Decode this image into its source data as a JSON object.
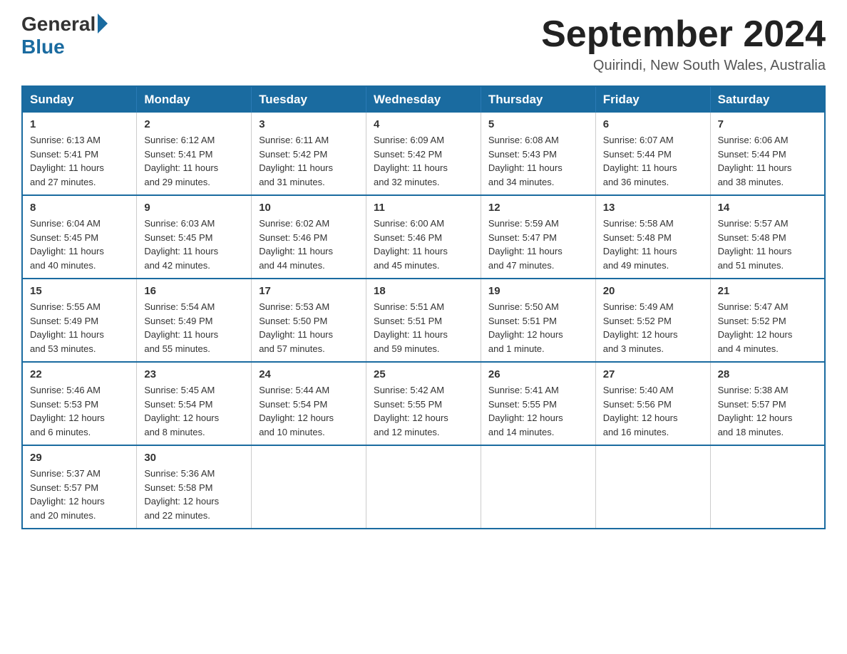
{
  "header": {
    "logo_general": "General",
    "logo_blue": "Blue",
    "month_title": "September 2024",
    "location": "Quirindi, New South Wales, Australia"
  },
  "calendar": {
    "days_of_week": [
      "Sunday",
      "Monday",
      "Tuesday",
      "Wednesday",
      "Thursday",
      "Friday",
      "Saturday"
    ],
    "weeks": [
      [
        {
          "day": "1",
          "sunrise": "6:13 AM",
          "sunset": "5:41 PM",
          "daylight": "11 hours and 27 minutes."
        },
        {
          "day": "2",
          "sunrise": "6:12 AM",
          "sunset": "5:41 PM",
          "daylight": "11 hours and 29 minutes."
        },
        {
          "day": "3",
          "sunrise": "6:11 AM",
          "sunset": "5:42 PM",
          "daylight": "11 hours and 31 minutes."
        },
        {
          "day": "4",
          "sunrise": "6:09 AM",
          "sunset": "5:42 PM",
          "daylight": "11 hours and 32 minutes."
        },
        {
          "day": "5",
          "sunrise": "6:08 AM",
          "sunset": "5:43 PM",
          "daylight": "11 hours and 34 minutes."
        },
        {
          "day": "6",
          "sunrise": "6:07 AM",
          "sunset": "5:44 PM",
          "daylight": "11 hours and 36 minutes."
        },
        {
          "day": "7",
          "sunrise": "6:06 AM",
          "sunset": "5:44 PM",
          "daylight": "11 hours and 38 minutes."
        }
      ],
      [
        {
          "day": "8",
          "sunrise": "6:04 AM",
          "sunset": "5:45 PM",
          "daylight": "11 hours and 40 minutes."
        },
        {
          "day": "9",
          "sunrise": "6:03 AM",
          "sunset": "5:45 PM",
          "daylight": "11 hours and 42 minutes."
        },
        {
          "day": "10",
          "sunrise": "6:02 AM",
          "sunset": "5:46 PM",
          "daylight": "11 hours and 44 minutes."
        },
        {
          "day": "11",
          "sunrise": "6:00 AM",
          "sunset": "5:46 PM",
          "daylight": "11 hours and 45 minutes."
        },
        {
          "day": "12",
          "sunrise": "5:59 AM",
          "sunset": "5:47 PM",
          "daylight": "11 hours and 47 minutes."
        },
        {
          "day": "13",
          "sunrise": "5:58 AM",
          "sunset": "5:48 PM",
          "daylight": "11 hours and 49 minutes."
        },
        {
          "day": "14",
          "sunrise": "5:57 AM",
          "sunset": "5:48 PM",
          "daylight": "11 hours and 51 minutes."
        }
      ],
      [
        {
          "day": "15",
          "sunrise": "5:55 AM",
          "sunset": "5:49 PM",
          "daylight": "11 hours and 53 minutes."
        },
        {
          "day": "16",
          "sunrise": "5:54 AM",
          "sunset": "5:49 PM",
          "daylight": "11 hours and 55 minutes."
        },
        {
          "day": "17",
          "sunrise": "5:53 AM",
          "sunset": "5:50 PM",
          "daylight": "11 hours and 57 minutes."
        },
        {
          "day": "18",
          "sunrise": "5:51 AM",
          "sunset": "5:51 PM",
          "daylight": "11 hours and 59 minutes."
        },
        {
          "day": "19",
          "sunrise": "5:50 AM",
          "sunset": "5:51 PM",
          "daylight": "12 hours and 1 minute."
        },
        {
          "day": "20",
          "sunrise": "5:49 AM",
          "sunset": "5:52 PM",
          "daylight": "12 hours and 3 minutes."
        },
        {
          "day": "21",
          "sunrise": "5:47 AM",
          "sunset": "5:52 PM",
          "daylight": "12 hours and 4 minutes."
        }
      ],
      [
        {
          "day": "22",
          "sunrise": "5:46 AM",
          "sunset": "5:53 PM",
          "daylight": "12 hours and 6 minutes."
        },
        {
          "day": "23",
          "sunrise": "5:45 AM",
          "sunset": "5:54 PM",
          "daylight": "12 hours and 8 minutes."
        },
        {
          "day": "24",
          "sunrise": "5:44 AM",
          "sunset": "5:54 PM",
          "daylight": "12 hours and 10 minutes."
        },
        {
          "day": "25",
          "sunrise": "5:42 AM",
          "sunset": "5:55 PM",
          "daylight": "12 hours and 12 minutes."
        },
        {
          "day": "26",
          "sunrise": "5:41 AM",
          "sunset": "5:55 PM",
          "daylight": "12 hours and 14 minutes."
        },
        {
          "day": "27",
          "sunrise": "5:40 AM",
          "sunset": "5:56 PM",
          "daylight": "12 hours and 16 minutes."
        },
        {
          "day": "28",
          "sunrise": "5:38 AM",
          "sunset": "5:57 PM",
          "daylight": "12 hours and 18 minutes."
        }
      ],
      [
        {
          "day": "29",
          "sunrise": "5:37 AM",
          "sunset": "5:57 PM",
          "daylight": "12 hours and 20 minutes."
        },
        {
          "day": "30",
          "sunrise": "5:36 AM",
          "sunset": "5:58 PM",
          "daylight": "12 hours and 22 minutes."
        },
        null,
        null,
        null,
        null,
        null
      ]
    ],
    "labels": {
      "sunrise": "Sunrise:",
      "sunset": "Sunset:",
      "daylight": "Daylight:"
    }
  }
}
